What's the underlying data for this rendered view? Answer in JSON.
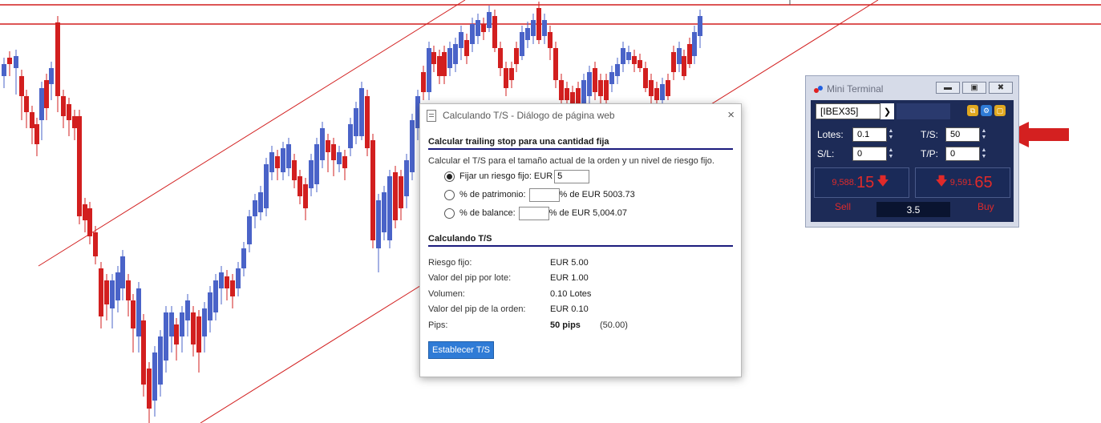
{
  "colors": {
    "bull": "#4a63c8",
    "bear": "#d21f1f",
    "line": "#d21f1f",
    "arrow": "#d42020",
    "button": "#2f7bd6",
    "terminal_bg": "#1d2b57"
  },
  "dialog": {
    "title": "Calculando T/S - Diálogo de página web",
    "close_icon": "×",
    "section1_title": "Calcular trailing stop para una cantidad fija",
    "section1_desc": "Calcular el T/S para el tamaño actual de la orden y un nivel de riesgo fijo.",
    "option_fixed_label": "Fijar un riesgo fijo: EUR",
    "option_fixed_value": "5",
    "option_equity_label": "% de patrimonio:",
    "option_equity_suffix": "% de EUR 5003.73",
    "option_balance_label": "% de balance:",
    "option_balance_suffix": "% de EUR 5,004.07",
    "selected_option": "fixed",
    "section2_title": "Calculando T/S",
    "results": [
      {
        "label": "Riesgo fijo:",
        "value": "EUR 5.00",
        "extra": ""
      },
      {
        "label": "Valor del pip por lote:",
        "value": "EUR 1.00",
        "extra": ""
      },
      {
        "label": "Volumen:",
        "value": "0.10 Lotes",
        "extra": ""
      },
      {
        "label": "Valor del pip de la orden:",
        "value": "EUR 0.10",
        "extra": ""
      },
      {
        "label": "Pips:",
        "value": "50 pips",
        "extra": "(50.00)"
      }
    ],
    "set_button": "Establecer T/S"
  },
  "terminal": {
    "title": "Mini Terminal",
    "symbol": "[IBEX35]",
    "lots_label": "Lotes:",
    "lots_value": "0.1",
    "ts_label": "T/S:",
    "ts_value": "50",
    "sl_label": "S/L:",
    "sl_value": "0",
    "tp_label": "T/P:",
    "tp_value": "0",
    "sell_price_small": "9,588.",
    "sell_price_big": "15",
    "buy_price_small": "9,591.",
    "buy_price_big": "65",
    "sell_label": "Sell",
    "buy_label": "Buy",
    "spread": "3.5"
  }
}
